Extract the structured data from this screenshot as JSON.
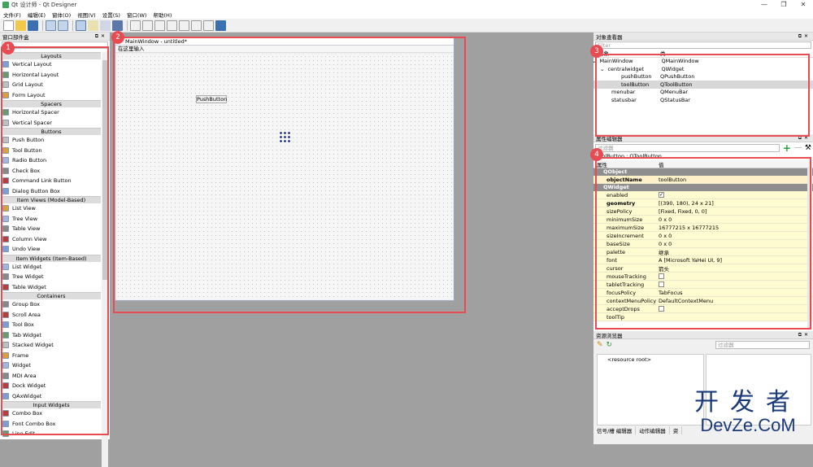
{
  "titlebar": {
    "title": "Qt 设计师 - Qt Designer",
    "min": "—",
    "max": "❐",
    "close": "✕"
  },
  "menus": [
    "文件(F)",
    "编辑(E)",
    "窗体(O)",
    "视图(V)",
    "设置(S)",
    "窗口(W)",
    "帮助(H)"
  ],
  "widget_box": {
    "title": "窗口部件盒",
    "groups": [
      {
        "name": "Layouts",
        "items": [
          "Vertical Layout",
          "Horizontal Layout",
          "Grid Layout",
          "Form Layout"
        ]
      },
      {
        "name": "Spacers",
        "items": [
          "Horizontal Spacer",
          "Vertical Spacer"
        ]
      },
      {
        "name": "Buttons",
        "items": [
          "Push Button",
          "Tool Button",
          "Radio Button",
          "Check Box",
          "Command Link Button",
          "Dialog Button Box"
        ]
      },
      {
        "name": "Item Views (Model-Based)",
        "items": [
          "List View",
          "Tree View",
          "Table View",
          "Column View",
          "Undo View"
        ]
      },
      {
        "name": "Item Widgets (Item-Based)",
        "items": [
          "List Widget",
          "Tree Widget",
          "Table Widget"
        ]
      },
      {
        "name": "Containers",
        "items": [
          "Group Box",
          "Scroll Area",
          "Tool Box",
          "Tab Widget",
          "Stacked Widget",
          "Frame",
          "Widget",
          "MDI Area",
          "Dock Widget",
          "QAxWidget"
        ]
      },
      {
        "name": "Input Widgets",
        "items": [
          "Combo Box",
          "Font Combo Box",
          "Line Edit"
        ]
      }
    ]
  },
  "form": {
    "title": "MainWindow - untitled*",
    "menu_placeholder": "在这里输入",
    "push_button": "PushButton"
  },
  "object_inspector": {
    "title": "对象查看器",
    "filter": "Filter",
    "col_object": "对象",
    "col_class": "类",
    "rows": [
      {
        "name": "MainWindow",
        "cls": "QMainWindow"
      },
      {
        "name": "centralwidget",
        "cls": "QWidget"
      },
      {
        "name": "pushButton",
        "cls": "QPushButton"
      },
      {
        "name": "toolButton",
        "cls": "QToolButton"
      },
      {
        "name": "menubar",
        "cls": "QMenuBar"
      },
      {
        "name": "statusbar",
        "cls": "QStatusBar"
      }
    ]
  },
  "property_editor": {
    "title": "属性编辑器",
    "filter": "过滤器",
    "object_label": "toolButton : QToolButton",
    "col_prop": "属性",
    "col_val": "值",
    "group1": "QObject",
    "object_name_prop": "objectName",
    "object_name_val": "toolButton",
    "group2": "QWidget",
    "rows": [
      {
        "p": "enabled",
        "v": ""
      },
      {
        "p": "geometry",
        "v": "[(390, 180), 24 x 21]"
      },
      {
        "p": "sizePolicy",
        "v": "[Fixed, Fixed, 0, 0]"
      },
      {
        "p": "minimumSize",
        "v": "0 x 0"
      },
      {
        "p": "maximumSize",
        "v": "16777215 x 16777215"
      },
      {
        "p": "sizeIncrement",
        "v": "0 x 0"
      },
      {
        "p": "baseSize",
        "v": "0 x 0"
      },
      {
        "p": "palette",
        "v": "继承"
      },
      {
        "p": "font",
        "v": "A  [Microsoft YaHei UI, 9]"
      },
      {
        "p": "cursor",
        "v": "箭头"
      },
      {
        "p": "mouseTracking",
        "v": ""
      },
      {
        "p": "tabletTracking",
        "v": ""
      },
      {
        "p": "focusPolicy",
        "v": "TabFocus"
      },
      {
        "p": "contextMenuPolicy",
        "v": "DefaultContextMenu"
      },
      {
        "p": "acceptDrops",
        "v": ""
      },
      {
        "p": "toolTip",
        "v": ""
      }
    ]
  },
  "resource_browser": {
    "title": "资源浏览器",
    "filter": "过滤器",
    "root": "<resource root>"
  },
  "bottom_tabs": [
    "信号/槽 编辑器",
    "动作编辑器",
    "资"
  ],
  "badges": [
    "1",
    "2",
    "3",
    "4"
  ],
  "watermark": {
    "line1": "开发者",
    "line2": "DevZe.CoM"
  }
}
